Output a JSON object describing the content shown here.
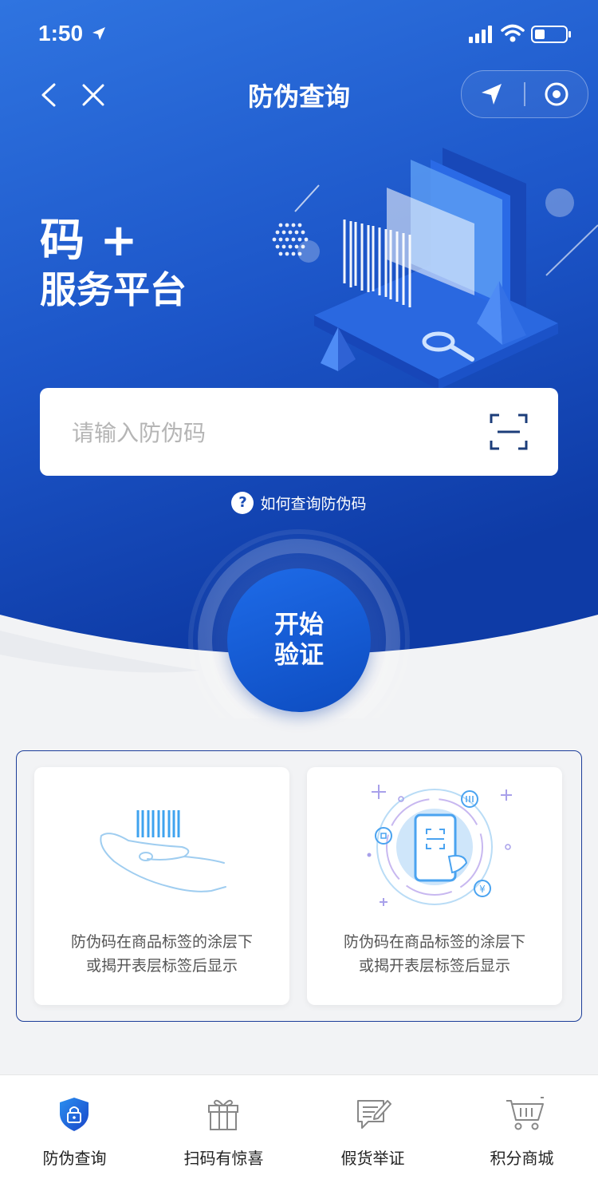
{
  "status_bar": {
    "time": "1:50"
  },
  "nav": {
    "title": "防伪查询"
  },
  "hero": {
    "headline_line1": "码 +",
    "headline_line2": "服务平台"
  },
  "search": {
    "placeholder": "请输入防伪码"
  },
  "help": {
    "icon": "?",
    "text": "如何查询防伪码"
  },
  "start_button": {
    "label": "开始验证"
  },
  "cards": [
    {
      "icon": "hand-barcode-icon",
      "line1": "防伪码在商品标签的涂层下",
      "line2": "或揭开表层标签后显示"
    },
    {
      "icon": "phone-scan-icon",
      "line1": "防伪码在商品标签的涂层下",
      "line2": "或揭开表层标签后显示"
    }
  ],
  "tabs": [
    {
      "label": "防伪查询",
      "icon": "shield-lock-icon",
      "active": true
    },
    {
      "label": "扫码有惊喜",
      "icon": "gift-icon",
      "active": false
    },
    {
      "label": "假货举证",
      "icon": "message-edit-icon",
      "active": false
    },
    {
      "label": "积分商城",
      "icon": "shopping-cart-icon",
      "active": false
    }
  ],
  "colors": {
    "primary": "#1a56d6",
    "primary_dark": "#0d3ca8",
    "accent_light": "#4aa3f0"
  }
}
